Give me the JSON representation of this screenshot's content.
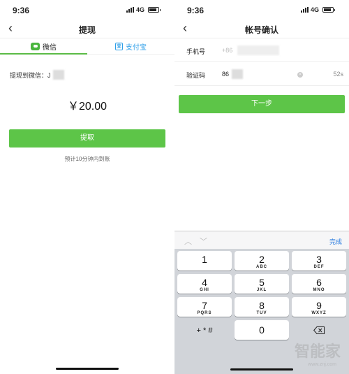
{
  "left": {
    "status": {
      "time": "9:36",
      "network": "4G"
    },
    "nav": {
      "back_icon": "‹",
      "title": "提现"
    },
    "tabs": [
      {
        "label": "微信",
        "icon": "wechat-icon"
      },
      {
        "label": "支付宝",
        "icon": "alipay-icon",
        "icon_glyph": "支"
      }
    ],
    "withdraw_to_label": "提现到微信：J",
    "amount": "￥20.00",
    "withdraw_button": "提取",
    "hint": "预计10分钟内到账"
  },
  "right": {
    "status": {
      "time": "9:36",
      "network": "4G"
    },
    "nav": {
      "back_icon": "‹",
      "title": "帐号确认"
    },
    "phone": {
      "label": "手机号",
      "value": "+86"
    },
    "code": {
      "label": "验证码",
      "value": "86",
      "countdown": "52s"
    },
    "next_button": "下一步",
    "keyboard": {
      "done": "完成",
      "keys": [
        {
          "num": "1",
          "letters": ""
        },
        {
          "num": "2",
          "letters": "ABC"
        },
        {
          "num": "3",
          "letters": "DEF"
        },
        {
          "num": "4",
          "letters": "GHI"
        },
        {
          "num": "5",
          "letters": "JKL"
        },
        {
          "num": "6",
          "letters": "MNO"
        },
        {
          "num": "7",
          "letters": "PQRS"
        },
        {
          "num": "8",
          "letters": "TUV"
        },
        {
          "num": "9",
          "letters": "WXYZ"
        }
      ],
      "symbols": "+ * #",
      "zero": "0"
    }
  },
  "watermark": {
    "text": "智能家",
    "url": "www.znj.com"
  },
  "colors": {
    "green": "#5dc548",
    "blue": "#2c9ee8",
    "done_blue": "#2f7fe0"
  }
}
